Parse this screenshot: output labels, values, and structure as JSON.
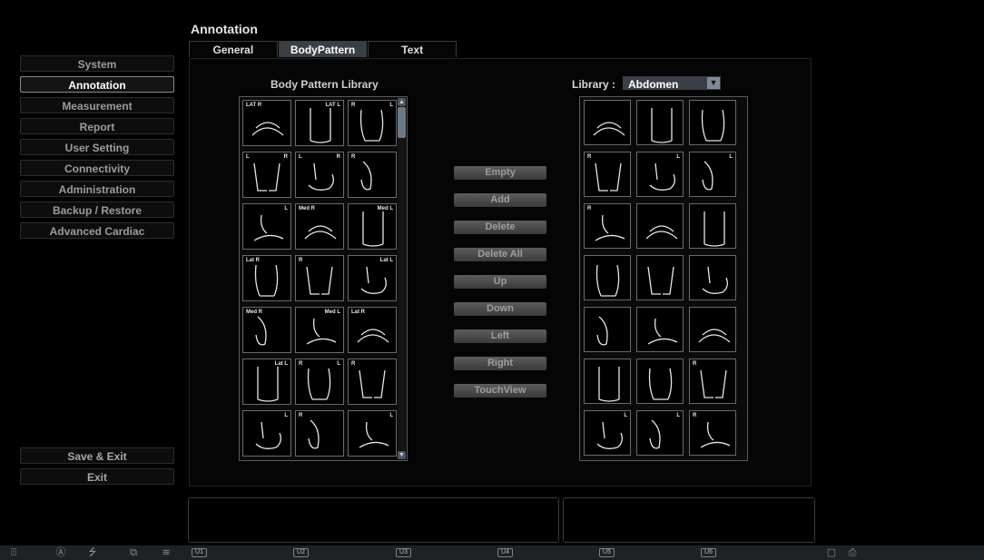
{
  "page": {
    "title": "Annotation"
  },
  "tabs": [
    {
      "label": "General",
      "active": false
    },
    {
      "label": "BodyPattern",
      "active": true
    },
    {
      "label": "Text",
      "active": false
    }
  ],
  "sidebar": {
    "items": [
      {
        "label": "System",
        "active": false
      },
      {
        "label": "Annotation",
        "active": true
      },
      {
        "label": "Measurement",
        "active": false
      },
      {
        "label": "Report",
        "active": false
      },
      {
        "label": "User Setting",
        "active": false
      },
      {
        "label": "Connectivity",
        "active": false
      },
      {
        "label": "Administration",
        "active": false
      },
      {
        "label": "Backup / Restore",
        "active": false
      },
      {
        "label": "Advanced Cardiac",
        "active": false
      }
    ],
    "bottom": {
      "save_exit": "Save & Exit",
      "exit": "Exit"
    }
  },
  "body_pattern_library": {
    "title": "Body Pattern Library",
    "cells": [
      {
        "label_left": "LAT R",
        "label_right": "",
        "icon": "leg-lateral-icon"
      },
      {
        "label_left": "",
        "label_right": "LAT L",
        "icon": "leg-lateral-icon"
      },
      {
        "label_left": "R",
        "label_right": "L",
        "icon": "legs-front-icon"
      },
      {
        "label_left": "L",
        "label_right": "R",
        "icon": "legs-back-icon"
      },
      {
        "label_left": "L",
        "label_right": "R",
        "icon": "feet-back-icon"
      },
      {
        "label_left": "R",
        "label_right": "",
        "icon": "foot-side-icon"
      },
      {
        "label_left": "",
        "label_right": "L",
        "icon": "foot-side-icon"
      },
      {
        "label_left": "Med R",
        "label_right": "",
        "icon": "foot-medial-icon"
      },
      {
        "label_left": "",
        "label_right": "Med L",
        "icon": "foot-medial-icon"
      },
      {
        "label_left": "Lat R",
        "label_right": "",
        "icon": "foot-lateral-icon"
      },
      {
        "label_left": "R",
        "label_right": "",
        "icon": "ankle-icon"
      },
      {
        "label_left": "",
        "label_right": "Lat L",
        "icon": "foot-lateral-icon"
      },
      {
        "label_left": "Med R",
        "label_right": "",
        "icon": "ankle-medial-icon"
      },
      {
        "label_left": "",
        "label_right": "Med L",
        "icon": "ankle-medial-icon"
      },
      {
        "label_left": "Lat R",
        "label_right": "",
        "icon": "ankle-lateral-icon"
      },
      {
        "label_left": "",
        "label_right": "Lat L",
        "icon": "ankle-lateral-icon"
      },
      {
        "label_left": "R",
        "label_right": "L",
        "icon": "feet-top-icon"
      },
      {
        "label_left": "R",
        "label_right": "",
        "icon": "foot-top-icon"
      },
      {
        "label_left": "",
        "label_right": "L",
        "icon": "foot-top-icon"
      },
      {
        "label_left": "R",
        "label_right": "",
        "icon": "foot-sole-icon"
      },
      {
        "label_left": "",
        "label_right": "L",
        "icon": "foot-sole-icon"
      }
    ],
    "scroll": {
      "up_icon": "scroll-up-icon",
      "down_icon": "scroll-down-icon"
    }
  },
  "actions": {
    "empty": "Empty",
    "add": "Add",
    "delete": "Delete",
    "delete_all": "Delete All",
    "up": "Up",
    "down": "Down",
    "left": "Left",
    "right": "Right",
    "touchview": "TouchView"
  },
  "library": {
    "label": "Library :",
    "selected": "Abdomen",
    "cells": [
      {
        "label_left": "",
        "label_right": "",
        "icon": "lungs-icon"
      },
      {
        "label_left": "",
        "label_right": "",
        "icon": "abdomen-front-icon"
      },
      {
        "label_left": "",
        "label_right": "",
        "icon": "chest-front-icon"
      },
      {
        "label_left": "R",
        "label_right": "",
        "icon": "torso-right-icon"
      },
      {
        "label_left": "",
        "label_right": "L",
        "icon": "torso-left-icon"
      },
      {
        "label_left": "",
        "label_right": "L",
        "icon": "flank-left-icon"
      },
      {
        "label_left": "R",
        "label_right": "",
        "icon": "flank-right-icon"
      },
      {
        "label_left": "",
        "label_right": "",
        "icon": "back-icon"
      },
      {
        "label_left": "",
        "label_right": "",
        "icon": "liver-icon"
      },
      {
        "label_left": "",
        "label_right": "",
        "icon": "pancreas-icon"
      },
      {
        "label_left": "",
        "label_right": "",
        "icon": "gallbladder-icon"
      },
      {
        "label_left": "",
        "label_right": "",
        "icon": "kidney-icon"
      },
      {
        "label_left": "",
        "label_right": "",
        "icon": "kidney-left-icon"
      },
      {
        "label_left": "",
        "label_right": "",
        "icon": "urinary-tract-icon"
      },
      {
        "label_left": "",
        "label_right": "",
        "icon": "stomach-icon"
      },
      {
        "label_left": "",
        "label_right": "",
        "icon": "colon-icon"
      },
      {
        "label_left": "",
        "label_right": "",
        "icon": "appendix-icon"
      },
      {
        "label_left": "R",
        "label_right": "",
        "icon": "body-side-icon"
      },
      {
        "label_left": "",
        "label_right": "L",
        "icon": "body-side-icon"
      },
      {
        "label_left": "",
        "label_right": "L",
        "icon": "body-lying-icon"
      },
      {
        "label_left": "R",
        "label_right": "",
        "icon": "body-lying-icon"
      }
    ]
  },
  "status_bar": {
    "left_icons": [
      "patient-info-icon",
      "auto-icon",
      "usb-icon",
      "network-icon",
      "wifi-icon"
    ],
    "user_keys": [
      "U1",
      "U2",
      "U3",
      "U4",
      "U5",
      "U6"
    ],
    "right_icons": [
      "window-icon",
      "printer-icon"
    ]
  }
}
